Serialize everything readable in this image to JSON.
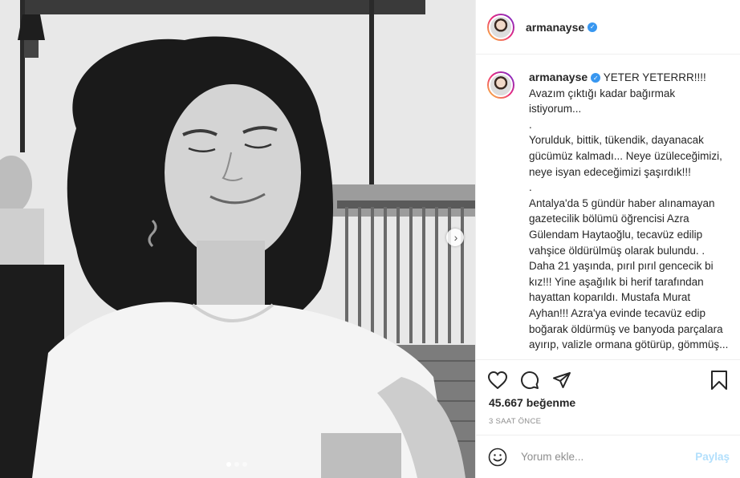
{
  "post": {
    "username": "armanayse",
    "verified": true,
    "caption": "YETER YETERRR!!!!\nAvazım çıktığı kadar bağırmak istiyorum...\n.\nYorulduk, bittik, tükendik, dayanacak gücümüz kalmadı... Neye üzüleceğimizi, neye isyan edeceğimizi şaşırdık!!!\n.\nAntalya'da 5 gündür haber alınamayan gazetecilik bölümü öğrencisi Azra Gülendam Haytaoğlu, tecavüz edilip vahşice öldürülmüş olarak bulundu. .\nDaha 21 yaşında, pırıl pırıl gencecik bi kız!!! Yine aşağılık bi herif tarafından hayattan koparıldı. Mustafa Murat Ayhan!!! Azra'ya evinde tecavüz edip boğarak öldürmüş ve banyoda parçalara ayırıp, valizle ormana götürüp, gömmüş...",
    "likes": "45.667 beğenme",
    "time": "3 SAAT ÖNCE"
  },
  "comment_box": {
    "placeholder": "Yorum ekle...",
    "post_label": "Paylaş"
  },
  "carousel": {
    "slides": 3,
    "active": 1
  },
  "icons": {
    "like": "heart-icon",
    "comment": "comment-icon",
    "share": "share-icon",
    "save": "bookmark-icon",
    "emoji": "emoji-icon",
    "next": "chevron-right-icon",
    "verified": "verified-badge-icon"
  },
  "colors": {
    "verified": "#3897f0",
    "post_button": "#b2dffc",
    "muted": "#8e8e8e"
  }
}
